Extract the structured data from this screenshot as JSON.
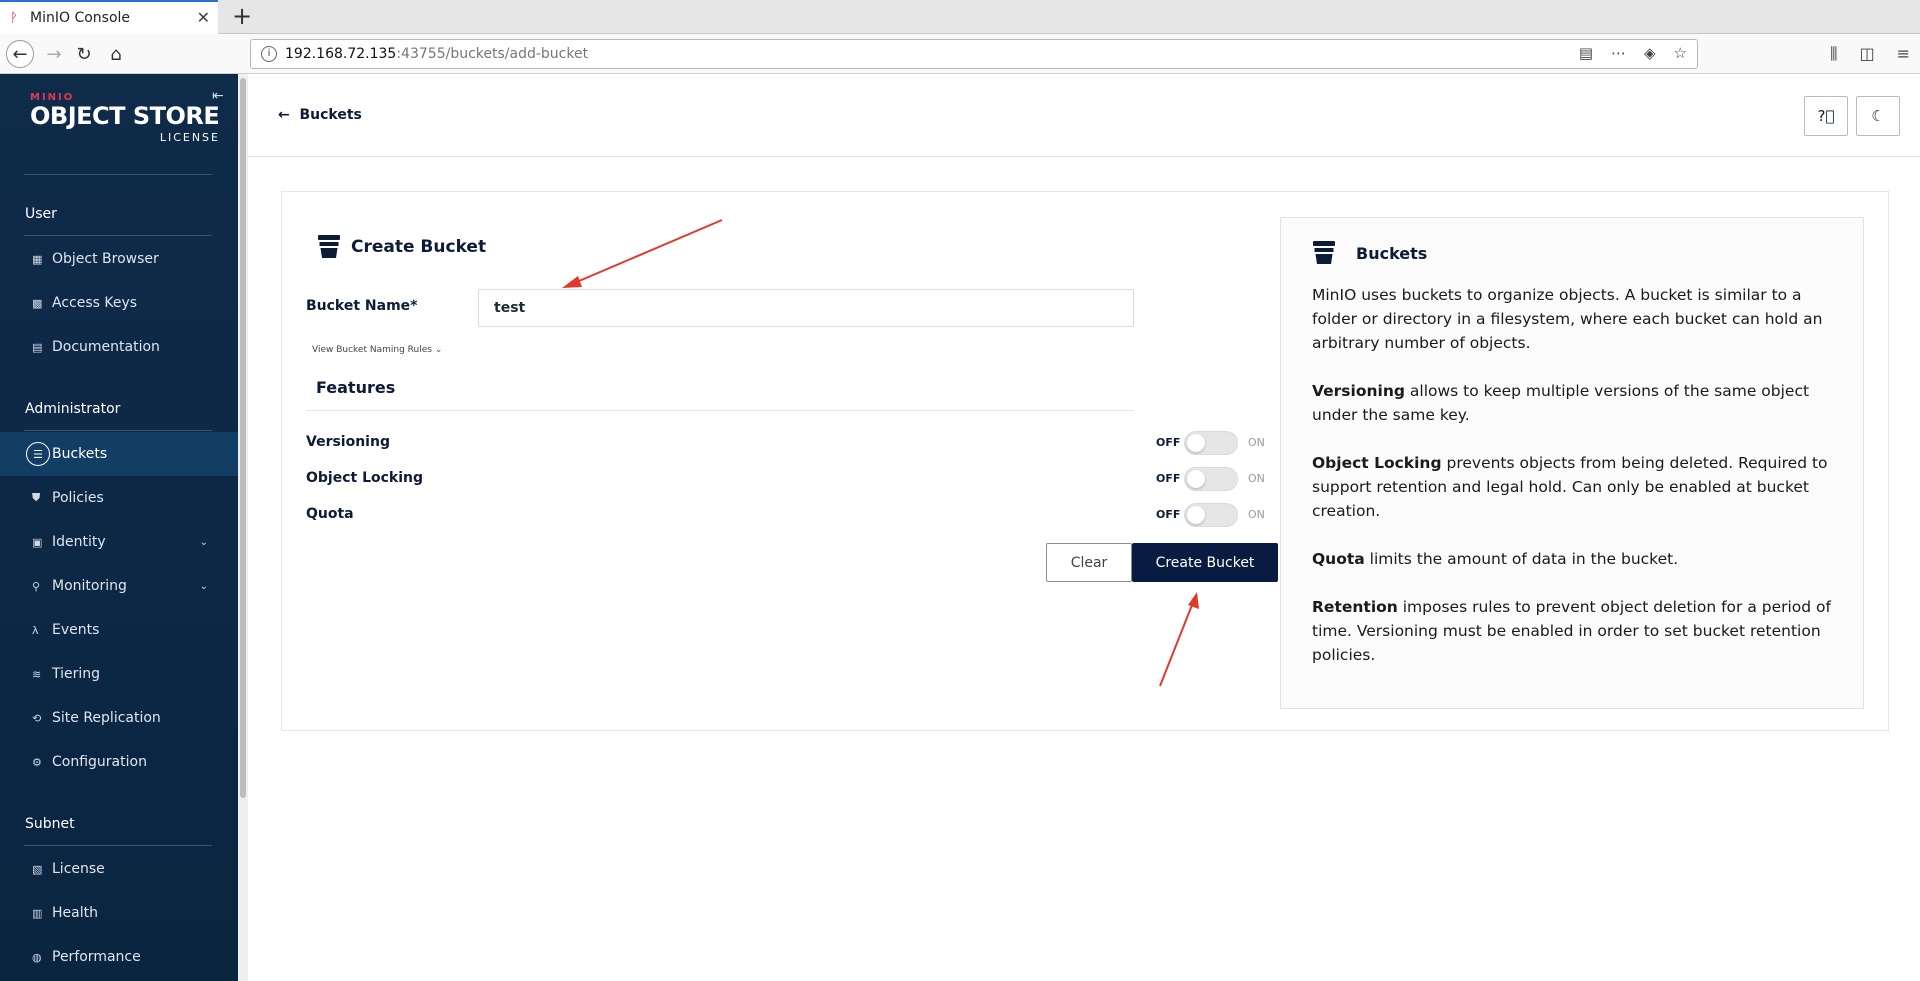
{
  "browser": {
    "tab_title": "MinIO Console",
    "url_host": "192.168.72.135",
    "url_path": ":43755/buckets/add-bucket"
  },
  "sidebar": {
    "logo_small": "MINIO",
    "logo_main": "OBJECT STORE",
    "logo_sub": "LICENSE",
    "sections": [
      {
        "title": "User",
        "items": [
          {
            "label": "Object Browser",
            "icon": "object-browser-icon"
          },
          {
            "label": "Access Keys",
            "icon": "key-icon"
          },
          {
            "label": "Documentation",
            "icon": "doc-icon"
          }
        ]
      },
      {
        "title": "Administrator",
        "items": [
          {
            "label": "Buckets",
            "icon": "bucket-icon"
          },
          {
            "label": "Policies",
            "icon": "shield-icon"
          },
          {
            "label": "Identity",
            "icon": "id-icon"
          },
          {
            "label": "Monitoring",
            "icon": "search-icon"
          },
          {
            "label": "Events",
            "icon": "lambda-icon"
          },
          {
            "label": "Tiering",
            "icon": "layers-icon"
          },
          {
            "label": "Site Replication",
            "icon": "replicate-icon"
          },
          {
            "label": "Configuration",
            "icon": "gear-icon"
          }
        ]
      },
      {
        "title": "Subnet",
        "items": [
          {
            "label": "License",
            "icon": "license-icon"
          },
          {
            "label": "Health",
            "icon": "health-icon"
          },
          {
            "label": "Performance",
            "icon": "gauge-icon"
          }
        ]
      }
    ]
  },
  "header": {
    "back_label": "Buckets"
  },
  "form": {
    "title": "Create Bucket",
    "name_label": "Bucket Name*",
    "name_value": "test",
    "naming_rules": "View Bucket Naming Rules",
    "features_title": "Features",
    "features": [
      {
        "label": "Versioning",
        "state": "OFF",
        "alt": "ON"
      },
      {
        "label": "Object Locking",
        "state": "OFF",
        "alt": "ON"
      },
      {
        "label": "Quota",
        "state": "OFF",
        "alt": "ON"
      }
    ],
    "clear_label": "Clear",
    "create_label": "Create Bucket"
  },
  "help": {
    "title": "Buckets",
    "intro": "MinIO uses buckets to organize objects. A bucket is similar to a folder or directory in a filesystem, where each bucket can hold an arbitrary number of objects.",
    "versioning_term": "Versioning",
    "versioning_text": " allows to keep multiple versions of the same object under the same key.",
    "locking_term": "Object Locking",
    "locking_text": " prevents objects from being deleted. Required to support retention and legal hold. Can only be enabled at bucket creation.",
    "quota_term": "Quota",
    "quota_text": " limits the amount of data in the bucket.",
    "retention_term": "Retention",
    "retention_text": " imposes rules to prevent object deletion for a period of time. Versioning must be enabled in order to set bucket retention policies."
  },
  "colors": {
    "sidebar": "#0f2b4a",
    "primary": "#081c42",
    "annotation": "#e3392c"
  }
}
